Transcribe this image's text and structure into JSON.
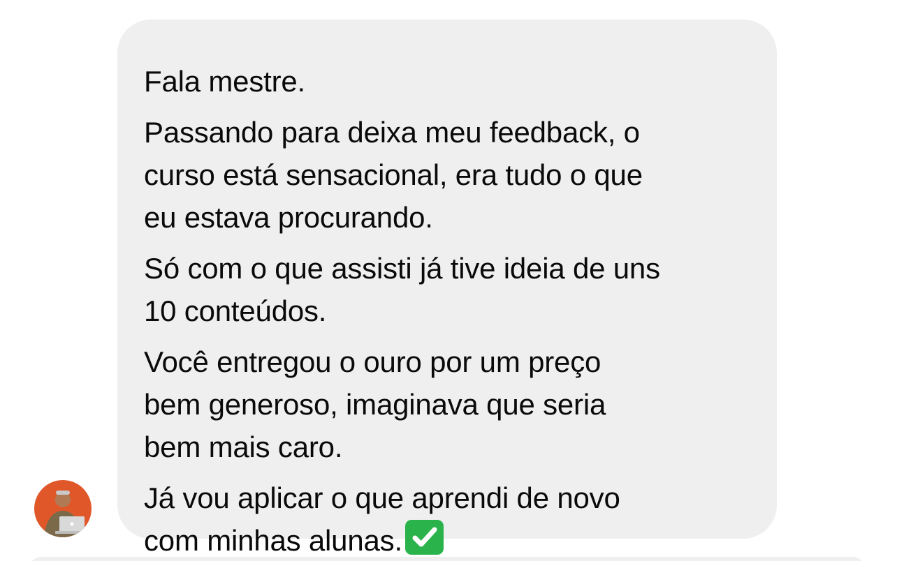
{
  "message": {
    "paragraphs": [
      {
        "lines": [
          "Fala mestre."
        ]
      },
      {
        "lines": [
          "Passando para deixa meu feedback, o",
          "curso está sensacional, era tudo o que",
          "eu estava procurando."
        ]
      },
      {
        "lines": [
          "Só com o que assisti já tive ideia de uns",
          "10 conteúdos."
        ]
      },
      {
        "lines": [
          "Você entregou o ouro por um preço",
          "bem generoso, imaginava que seria",
          "bem mais caro."
        ]
      },
      {
        "lines": [
          "Já vou aplicar o que aprendi de novo",
          "com minhas alunas."
        ]
      }
    ],
    "trailing_emoji": "check-mark-button-icon"
  },
  "sender": {
    "avatar_icon": "user-avatar-photo"
  },
  "colors": {
    "bubble": "#efefef",
    "text": "#0a0a0a",
    "check_green": "#2bb34b",
    "avatar_orange": "#e0582a"
  }
}
